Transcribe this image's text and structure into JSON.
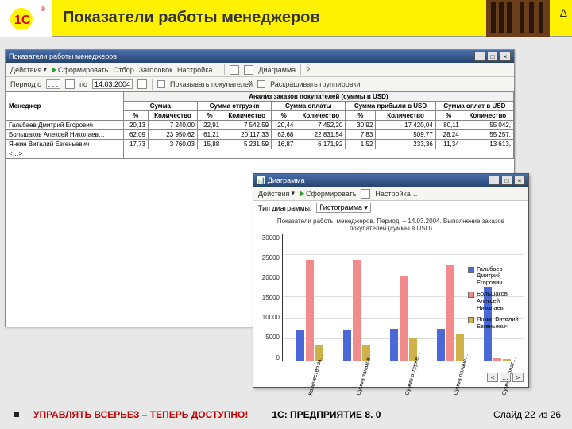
{
  "title": "Показатели работы менеджеров",
  "triangle": "Δ",
  "footer": {
    "left": "УПРАВЛЯТЬ ВСЕРЬЕЗ – ТЕПЕРЬ ДОСТУПНО!",
    "mid": "1С: ПРЕДПРИЯТИЕ 8. 0",
    "right": "Слайд 22 из 26"
  },
  "mainwin": {
    "title": "Показатели работы менеджеров",
    "toolbar": {
      "actions": "Действия",
      "form": "Сформировать",
      "filter": "Отбор",
      "header": "Заголовок",
      "settings": "Настройка…",
      "diagram": "Диаграмма",
      "help": "?"
    },
    "toolbar2": {
      "period_from": "Период с",
      "date_to_label": "по",
      "date_to": "14.03.2004",
      "show_buyers": "Показывать покупателей",
      "color_groups": "Раскрашивать группировки"
    }
  },
  "table": {
    "manager_col": "Менеджер",
    "group_title": "Анализ заказов покупателей (суммы в USD)",
    "g_sum": "Сумма",
    "g_ship": "Сумма отгрузки",
    "g_pay": "Сумма оплаты",
    "g_profit": "Сумма прибыли в USD",
    "g_paid": "Сумма оплат в USD",
    "pct": "%",
    "qty": "Количество",
    "rows": [
      {
        "name": "Гальбаев Дмитрий Егорович",
        "p1": "20,13",
        "s1": "7 240,00",
        "p2": "22,91",
        "s2": "7 542,59",
        "p3": "20,44",
        "s3": "7 452,20",
        "p4": "30,92",
        "s4": "17 420,04",
        "p5": "80,11",
        "s5": "55 042,"
      },
      {
        "name": "Большаков Алексей Николаев…",
        "p1": "62,09",
        "s1": "23 950,62",
        "p2": "61,21",
        "s2": "20 117,33",
        "p3": "62,68",
        "s3": "22 831,54",
        "p4": "7,83",
        "s4": "509,77",
        "p5": "28,24",
        "s5": "55 257,"
      },
      {
        "name": "Янкин Виталий Евгеньевич",
        "p1": "17,73",
        "s1": "3 760,03",
        "p2": "15,88",
        "s2": "5 231,59",
        "p3": "16,87",
        "s3": "6 171,92",
        "p4": "1,52",
        "s4": "233,36",
        "p5": "11,34",
        "s5": "13 613,"
      }
    ],
    "ellipsis": "<…>"
  },
  "chartwin": {
    "title": "Диаграмма",
    "actions": "Действия",
    "form": "Сформировать",
    "settings": "Настройка…",
    "type_label": "Тип диаграммы:",
    "type_value": "Гистограмма",
    "caption": "Показатели работы менеджеров. Период: – 14.03.2004. Выполнение заказов покупателей (суммы в USD)",
    "legend": [
      {
        "name": "Гальбаев Дмитрий Егорович",
        "color": "#4a68d8"
      },
      {
        "name": "Большаков Алексей Николаев",
        "color": "#f28b8b"
      },
      {
        "name": "Янкин Виталий Евгеньевич",
        "color": "#d0b24a"
      }
    ],
    "nav_prev": "<",
    "nav_sep": "…",
    "nav_next": ">"
  },
  "chart_data": {
    "type": "bar",
    "categories": [
      "Количество за…",
      "Сумма заказов",
      "Сумма отгруже…",
      "Сумма оплаче…",
      "Сумма оплат…"
    ],
    "series": [
      {
        "name": "Гальбаев Дмитрий Егорович",
        "values": [
          7240,
          7240,
          7543,
          7452,
          17420
        ]
      },
      {
        "name": "Большаков Алексей Николаев",
        "values": [
          23951,
          23951,
          20117,
          22832,
          510
        ]
      },
      {
        "name": "Янкин Виталий Евгеньевич",
        "values": [
          3760,
          3760,
          5232,
          6172,
          233
        ]
      }
    ],
    "ylim": [
      0,
      30000
    ],
    "yticks": [
      0,
      5000,
      10000,
      15000,
      20000,
      25000,
      30000
    ],
    "title": "Показатели работы менеджеров. Период: – 14.03.2004. Выполнение заказов покупателей (суммы в USD)"
  }
}
